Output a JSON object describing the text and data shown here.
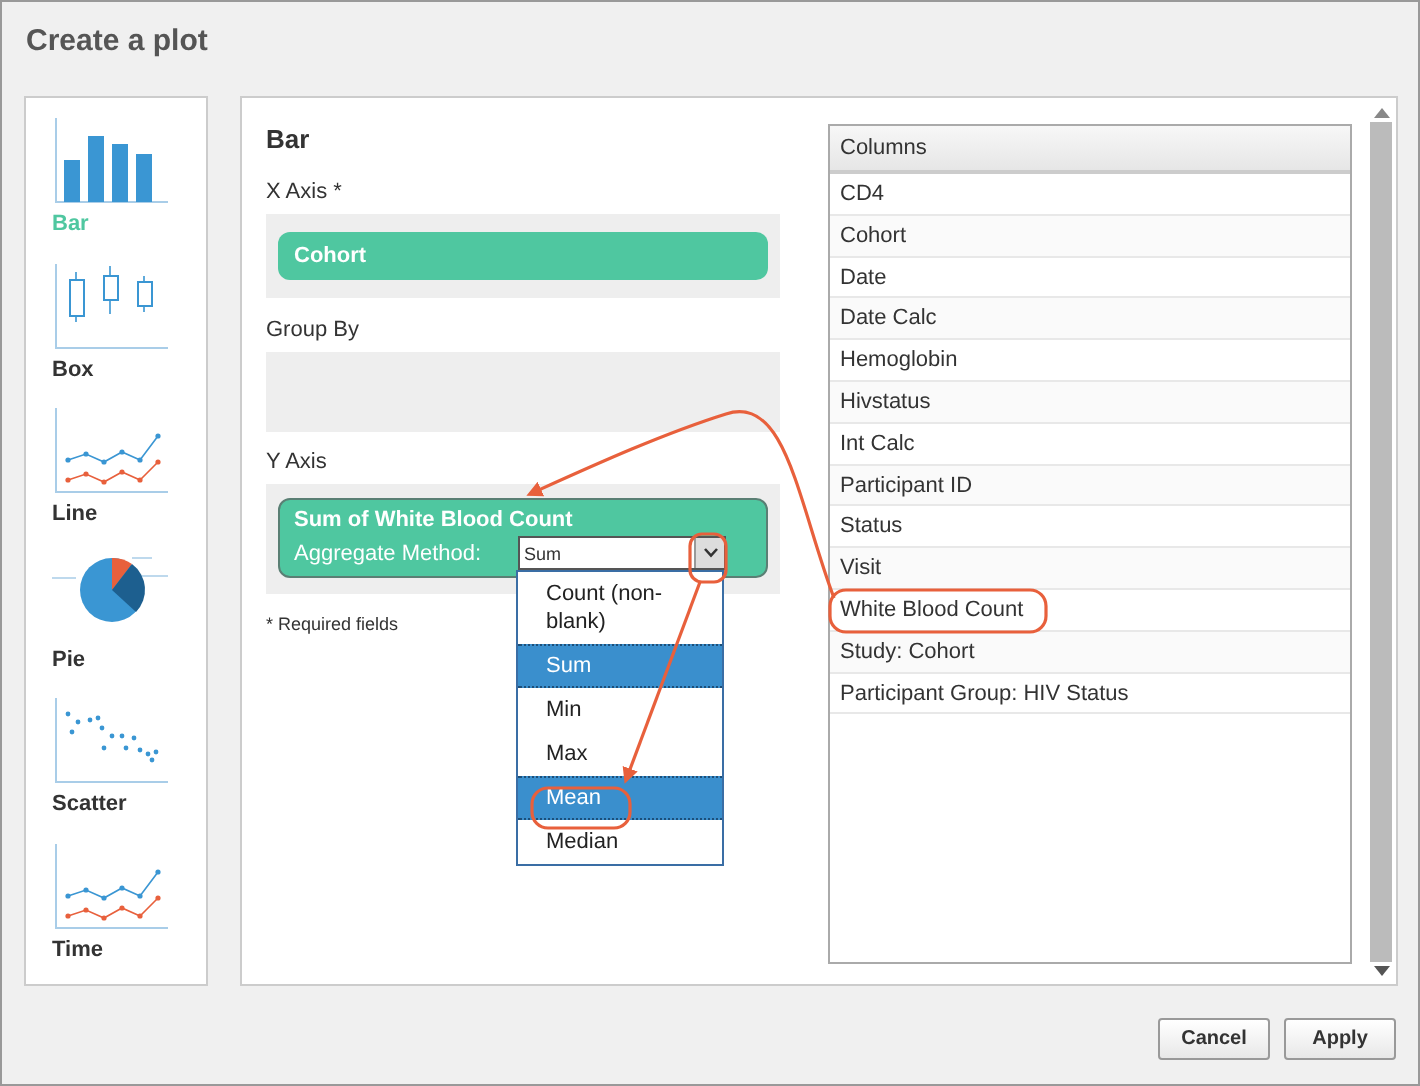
{
  "window": {
    "title": "Create a plot"
  },
  "chart_types": [
    {
      "kind": "bar",
      "label": "Bar",
      "selected": true
    },
    {
      "kind": "box",
      "label": "Box",
      "selected": false
    },
    {
      "kind": "line",
      "label": "Line",
      "selected": false
    },
    {
      "kind": "pie",
      "label": "Pie",
      "selected": false
    },
    {
      "kind": "scatter",
      "label": "Scatter",
      "selected": false
    },
    {
      "kind": "time",
      "label": "Time",
      "selected": false
    }
  ],
  "editor": {
    "heading": "Bar",
    "x_axis": {
      "label": "X Axis *",
      "field": "Cohort"
    },
    "group_by": {
      "label": "Group By"
    },
    "y_axis": {
      "label": "Y Axis",
      "field": "Sum of White Blood Count",
      "aggregate_label": "Aggregate Method:",
      "aggregate_value": "Sum",
      "options": [
        {
          "label": "Count (non-blank)",
          "highlighted": false
        },
        {
          "label": "Sum",
          "highlighted": true
        },
        {
          "label": "Min",
          "highlighted": false
        },
        {
          "label": "Max",
          "highlighted": false
        },
        {
          "label": "Mean",
          "highlighted": true
        },
        {
          "label": "Median",
          "highlighted": false
        }
      ]
    },
    "required_note": "* Required fields"
  },
  "columns": {
    "header": "Columns",
    "items": [
      "CD4",
      "Cohort",
      "Date",
      "Date Calc",
      "Hemoglobin",
      "Hivstatus",
      "Int Calc",
      "Participant ID",
      "Status",
      "Visit",
      "White Blood Count",
      "Study: Cohort",
      "Participant Group: HIV Status"
    ]
  },
  "buttons": [
    "Cancel",
    "Apply"
  ]
}
